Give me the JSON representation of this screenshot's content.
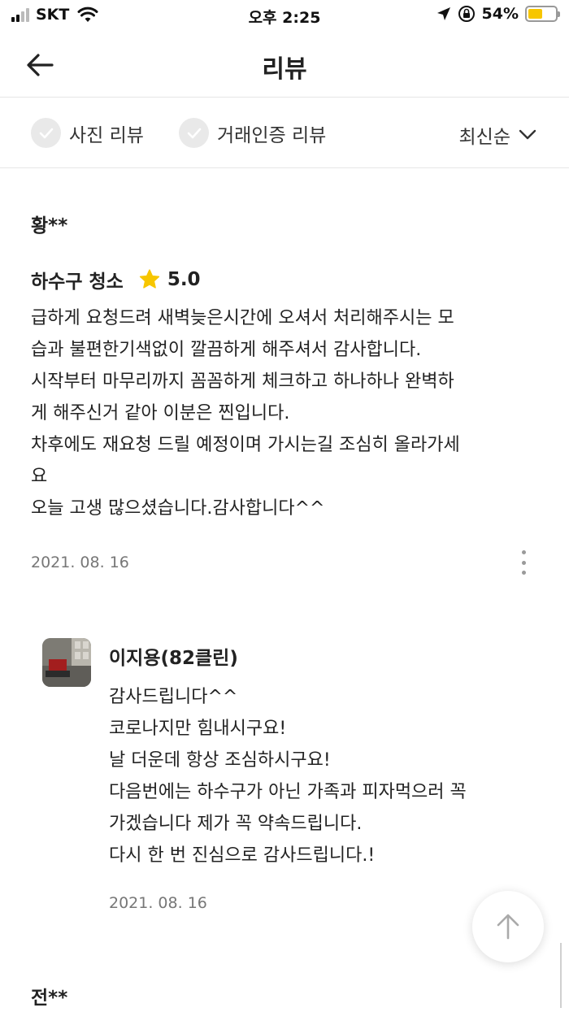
{
  "status_bar": {
    "carrier": "SKT",
    "time": "오후 2:25",
    "battery_percent": "54%",
    "battery_level": 0.54,
    "icons": [
      "signal-icon",
      "wifi-icon",
      "location-arrow-icon",
      "orientation-lock-icon",
      "battery-icon"
    ]
  },
  "header": {
    "title": "리뷰",
    "back_icon": "back-arrow-icon"
  },
  "filters": {
    "photo_review": "사진 리뷰",
    "verified_review": "거래인증 리뷰",
    "sort": "최신순"
  },
  "review": {
    "reviewer": "황**",
    "service": "하수구 청소",
    "rating": "5.0",
    "lines": [
      "급하게 요청드려 새벽늦은시간에 오셔서 처리해주시는 모",
      "습과 불편한기색없이 깔끔하게 해주셔서 감사합니다.",
      "시작부터 마무리까지 꼼꼼하게 체크하고 하나하나 완벽하",
      "게 해주신거 같아 이분은 찐입니다.",
      "차후에도 재요청 드릴 예정이며 가시는길 조심히 올라가세",
      "요",
      "오늘 고생 많으셨습니다.감사합니다^^"
    ],
    "date": "2021. 08. 16"
  },
  "reply": {
    "author": "이지용(82클린)",
    "lines": [
      "감사드립니다^^",
      "코로나지만 힘내시구요!",
      "날 더운데 항상 조심하시구요!",
      "다음번에는 하수구가 아닌 가족과 피자먹으러 꼭",
      "가겠습니다 제가 꼭 약속드립니다.",
      "다시 한 번 진심으로 감사드립니다.!"
    ],
    "date": "2021. 08. 16"
  },
  "next_review": {
    "reviewer": "전**"
  },
  "colors": {
    "star": "#f7c600",
    "battery": "#f7c600",
    "divider": "#e6e6e6",
    "muted_text": "#777777"
  }
}
